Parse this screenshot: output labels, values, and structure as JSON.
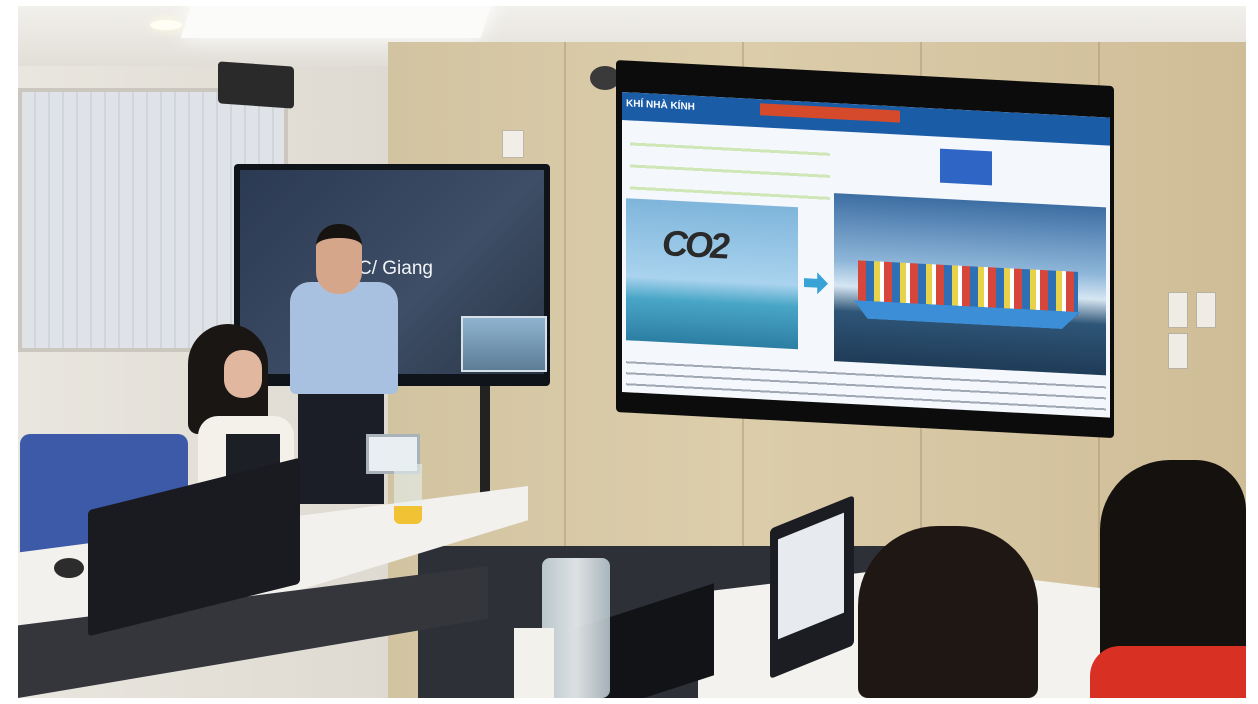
{
  "photo": {
    "left_tv_text": "C/ Giang",
    "slide_header": "KHÍ NHÀ KÍNH",
    "slide_molecule": "CO2"
  },
  "colors": {
    "wall_wood": "#d6c7a4",
    "slide_bar": "#1b5ca7",
    "chair": "#3c5aa8",
    "red_top": "#d83124"
  }
}
